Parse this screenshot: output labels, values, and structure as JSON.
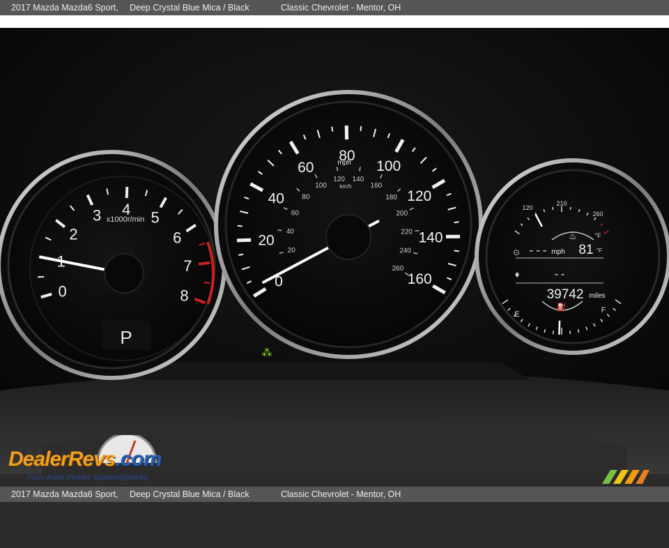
{
  "caption": {
    "vehicle": "2017 Mazda Mazda6 Sport,",
    "color": "Deep Crystal Blue Mica / Black",
    "dealer": "Classic Chevrolet - Mentor, OH"
  },
  "tachometer": {
    "unit": "x1000r/min",
    "ticks": [
      "0",
      "1",
      "2",
      "3",
      "4",
      "5",
      "6",
      "7",
      "8"
    ],
    "gear": "P",
    "reading_x1000": 1.0
  },
  "speedometer": {
    "mph_unit": "mph",
    "kmh_unit": "km/h",
    "mph_ticks": [
      "0",
      "20",
      "40",
      "60",
      "80",
      "100",
      "120",
      "140",
      "160"
    ],
    "kmh_ticks": [
      "20",
      "40",
      "60",
      "80",
      "100",
      "120",
      "140",
      "160",
      "180",
      "200",
      "220",
      "240",
      "260"
    ],
    "reading_mph": 0
  },
  "info_display": {
    "temp_low": "120",
    "temp_mid": "210",
    "temp_high": "260",
    "temp_unit": "°F",
    "speed_value": "---",
    "speed_unit": "mph",
    "outside_temp": "81",
    "outside_temp_unit": "°F",
    "range_value": "--",
    "odometer": "39742",
    "odometer_unit": "miles",
    "fuel_empty": "E",
    "fuel_full": "F"
  },
  "watermark": {
    "logo_part1": "Dealer",
    "logo_part2": "Revs",
    "logo_part3": ".com",
    "tagline": "Your Auto Dealer SuperHighway"
  },
  "colors": {
    "needle": "#ffffff",
    "redline": "#cc1f1f",
    "chrome": "#c9c9c9",
    "indicator_green": "#8fdc2a",
    "watermark_orange": "#f0a020",
    "watermark_blue": "#2a5fae"
  }
}
